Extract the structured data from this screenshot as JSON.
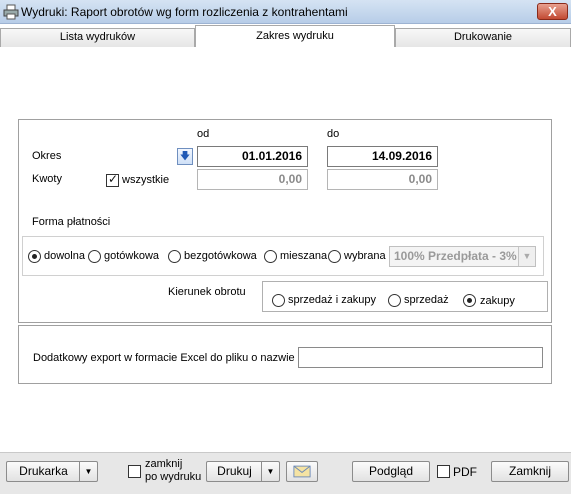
{
  "window": {
    "title": "Wydruki: Raport obrotów wg form rozliczenia z kontrahentami",
    "close_label": "X"
  },
  "tabs": [
    {
      "label": "Lista wydruków",
      "active": false
    },
    {
      "label": "Zakres wydruku",
      "active": true
    },
    {
      "label": "Drukowanie",
      "active": false
    }
  ],
  "range": {
    "from_header": "od",
    "to_header": "do",
    "period_label": "Okres",
    "period_from": "01.01.2016",
    "period_to": "14.09.2016",
    "amounts_label": "Kwoty",
    "all_label": "wszystkie",
    "all_checked": true,
    "amount_from": "0,00",
    "amount_to": "0,00",
    "arrow_icon": "arrow-down-icon"
  },
  "payment": {
    "section_label": "Forma płatności",
    "options": [
      {
        "label": "dowolna",
        "checked": true
      },
      {
        "label": "gotówkowa",
        "checked": false
      },
      {
        "label": "bezgotówkowa",
        "checked": false
      },
      {
        "label": "mieszana",
        "checked": false
      },
      {
        "label": "wybrana",
        "checked": false
      }
    ],
    "select_value": "100% Przedpłata - 3%"
  },
  "direction": {
    "label": "Kierunek obrotu",
    "options": [
      {
        "label": "sprzedaż i zakupy",
        "checked": false
      },
      {
        "label": "sprzedaż",
        "checked": false
      },
      {
        "label": "zakupy",
        "checked": true
      }
    ]
  },
  "export": {
    "label": "Dodatkowy export w formacie Excel do pliku o nazwie",
    "value": ""
  },
  "bottom": {
    "printer_label": "Drukarka",
    "close_after_print_line1": "zamknij",
    "close_after_print_line2": "po wydruku",
    "print_label": "Drukuj",
    "preview_label": "Podgląd",
    "pdf_label": "PDF",
    "close_label": "Zamknij",
    "envelope_icon": "envelope-icon"
  }
}
